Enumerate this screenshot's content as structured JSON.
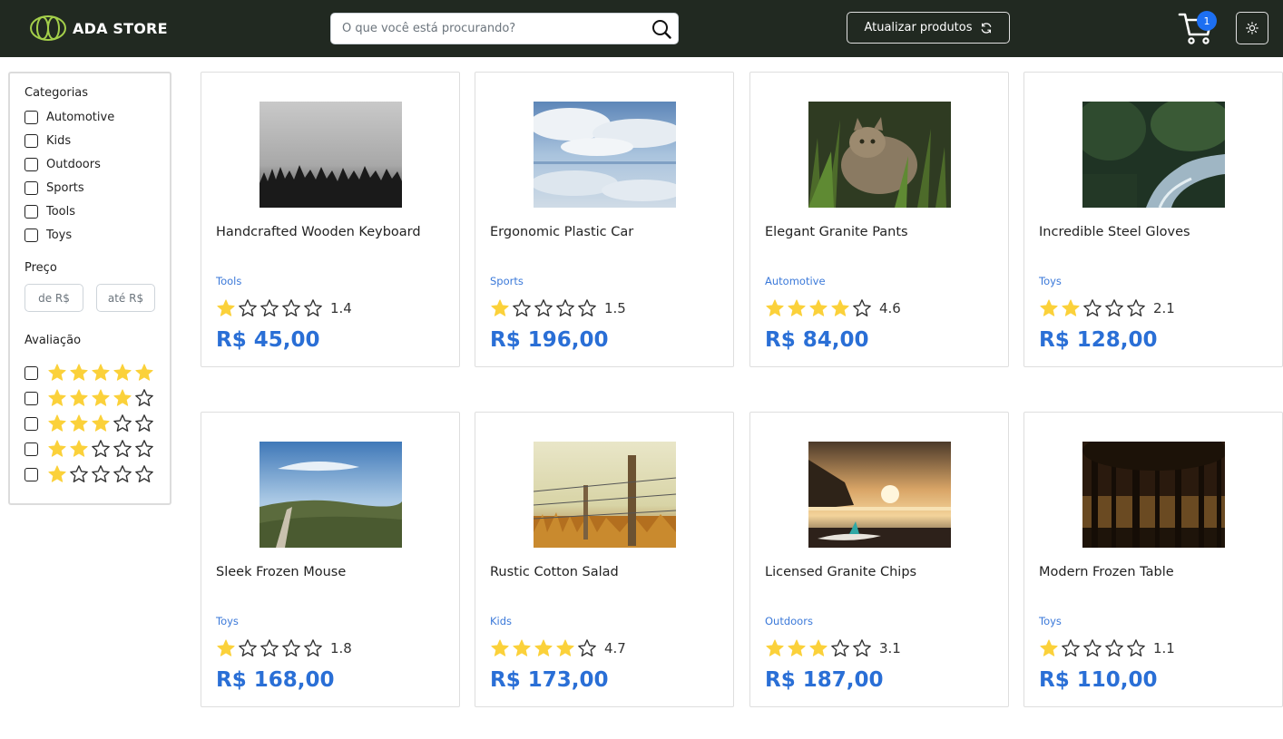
{
  "header": {
    "brand_name": "ADA STORE",
    "search_placeholder": "O que você está procurando?",
    "refresh_label": "Atualizar produtos",
    "cart_count": "1"
  },
  "sidebar": {
    "categories_title": "Categorias",
    "categories": [
      "Automotive",
      "Kids",
      "Outdoors",
      "Sports",
      "Tools",
      "Toys"
    ],
    "price_title": "Preço",
    "price_min_placeholder": "de R$",
    "price_max_placeholder": "até R$",
    "rating_title": "Avaliação",
    "rating_filters": [
      5,
      4,
      3,
      2,
      1
    ]
  },
  "products": [
    {
      "name": "Handcrafted Wooden Keyboard",
      "category": "Tools",
      "rating": "1.4",
      "price": "R$ 45,00",
      "image": "foggy-forest"
    },
    {
      "name": "Ergonomic Plastic Car",
      "category": "Sports",
      "rating": "1.5",
      "price": "R$ 196,00",
      "image": "cloud-reflection"
    },
    {
      "name": "Elegant Granite Pants",
      "category": "Automotive",
      "rating": "4.6",
      "price": "R$ 84,00",
      "image": "kitten-grass"
    },
    {
      "name": "Incredible Steel Gloves",
      "category": "Toys",
      "rating": "2.1",
      "price": "R$ 128,00",
      "image": "forest-stream"
    },
    {
      "name": "Sleek Frozen Mouse",
      "category": "Toys",
      "rating": "1.8",
      "price": "R$ 168,00",
      "image": "hill-path"
    },
    {
      "name": "Rustic Cotton Salad",
      "category": "Kids",
      "rating": "4.7",
      "price": "R$ 173,00",
      "image": "fence-field"
    },
    {
      "name": "Licensed Granite Chips",
      "category": "Outdoors",
      "rating": "3.1",
      "price": "R$ 187,00",
      "image": "beach-sunset-surfboard"
    },
    {
      "name": "Modern Frozen Table",
      "category": "Toys",
      "rating": "1.1",
      "price": "R$ 110,00",
      "image": "dark-woods"
    }
  ],
  "colors": {
    "header_bg": "#212921",
    "accent_blue": "#2a6fd6",
    "star_yellow": "#fbd13a",
    "badge_blue": "#1d6ff2"
  }
}
